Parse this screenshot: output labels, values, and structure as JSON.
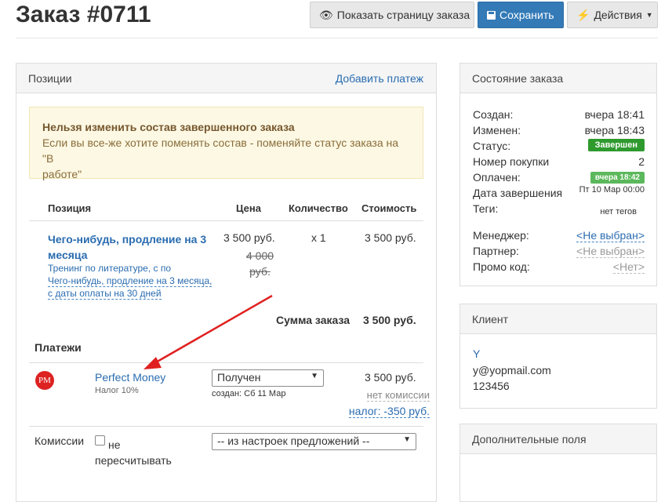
{
  "header": {
    "title": "Заказ #0711",
    "show_order_page": "Показать страницу заказа",
    "save": "Сохранить",
    "actions": "Действия"
  },
  "positions_panel": {
    "title": "Позиции",
    "add_payment": "Добавить платеж",
    "alert_title": "Нельзя изменить состав завершенного заказа",
    "alert_text": "Если вы все-же хотите поменять состав - поменяйте статус заказа на \"В работе",
    "alert_text2": "работе\"",
    "columns": {
      "position": "Позиция",
      "price": "Цена",
      "quantity": "Количество",
      "cost": "Стоимость"
    },
    "item": {
      "name_line1": "Чего-нибудь, продление на 3",
      "name_line2": "месяца",
      "desc_line1": "Тренинг по литературе, с по",
      "desc_line2": "Чего-нибудь, продление на 3 месяца,",
      "desc_line3": "с даты оплаты на 30 дней",
      "price": "3 500 руб.",
      "old_price_line1": "4 000",
      "old_price_line2": "руб.",
      "quantity": "x 1",
      "cost": "3 500 руб."
    },
    "order_sum_label": "Сумма заказа",
    "order_sum_value": "3 500 руб.",
    "payments_title": "Платежи",
    "payment": {
      "logo": "PM",
      "name": "Perfect Money",
      "tax": "Налог 10%",
      "status": "Получен",
      "created": "создан: Сб 11 Мар",
      "amount": "3 500 руб.",
      "commission": "нет комиссии",
      "tax_amount": "налог: -350 руб."
    },
    "commissions_label": "Комиссии",
    "no_recalc_line1": "не",
    "no_recalc_line2": "пересчитывать",
    "commission_select": "-- из настроек предложений --"
  },
  "status_panel": {
    "title": "Состояние заказа",
    "created_label": "Создан:",
    "created_value": "вчера 18:41",
    "changed_label": "Изменен:",
    "changed_value": "вчера 18:43",
    "status_label": "Статус:",
    "status_value": "Завершен",
    "purchase_label": "Номер покупки",
    "purchase_value": "2",
    "paid_label": "Оплачен:",
    "paid_value": "вчера 18:42",
    "completed_label": "Дата завершения",
    "completed_value": "Пт 10 Мар 00:00",
    "tags_label": "Теги:",
    "tags_value": "нет тегов",
    "manager_label": "Менеджер:",
    "manager_value": "<Не выбран>",
    "partner_label": "Партнер:",
    "partner_value": "<Не выбран>",
    "promo_label": "Промо код:",
    "promo_value": "<Нет>"
  },
  "client_panel": {
    "title": "Клиент",
    "name": "Y",
    "email": "y@yopmail.com",
    "phone": "123456"
  },
  "extra_panel": {
    "title": "Дополнительные поля"
  },
  "colors": {
    "accent": "#337ab7",
    "success": "#2e9a2e",
    "success_light": "#5cb85c",
    "arrow": "#e02020"
  }
}
